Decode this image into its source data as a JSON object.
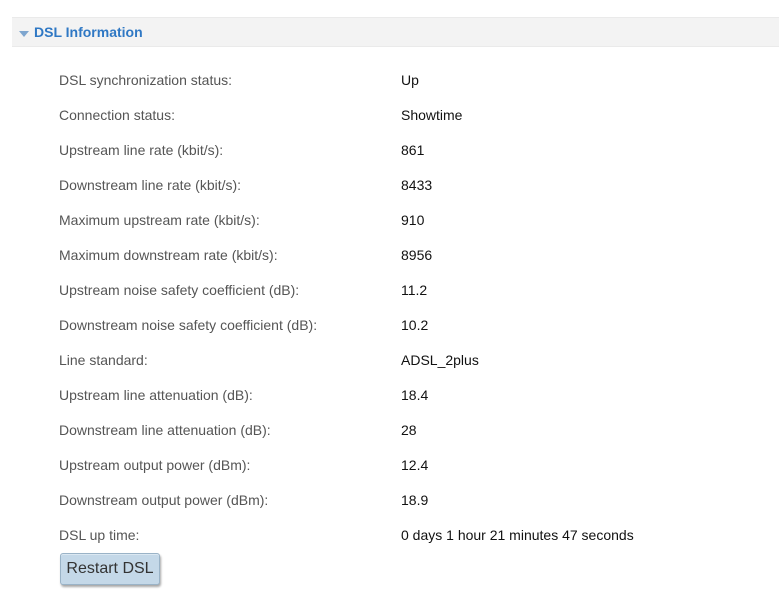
{
  "section": {
    "title": "DSL Information"
  },
  "rows": [
    {
      "label": "DSL synchronization status:",
      "value": "Up"
    },
    {
      "label": "Connection status:",
      "value": "Showtime"
    },
    {
      "label": "Upstream line rate (kbit/s):",
      "value": "861"
    },
    {
      "label": "Downstream line rate (kbit/s):",
      "value": "8433"
    },
    {
      "label": "Maximum upstream rate (kbit/s):",
      "value": "910"
    },
    {
      "label": "Maximum downstream rate (kbit/s):",
      "value": "8956"
    },
    {
      "label": "Upstream noise safety coefficient (dB):",
      "value": "11.2"
    },
    {
      "label": "Downstream noise safety coefficient (dB):",
      "value": "10.2"
    },
    {
      "label": "Line standard:",
      "value": "ADSL_2plus"
    },
    {
      "label": "Upstream line attenuation (dB):",
      "value": "18.4"
    },
    {
      "label": "Downstream line attenuation (dB):",
      "value": "28"
    },
    {
      "label": "Upstream output power (dBm):",
      "value": "12.4"
    },
    {
      "label": "Downstream output power (dBm):",
      "value": "18.9"
    },
    {
      "label": "DSL up time:",
      "value": "0 days 1 hour 21 minutes 47 seconds"
    }
  ],
  "actions": {
    "restart_label": "Restart DSL"
  },
  "colors": {
    "section_title": "#2f78c4",
    "header_bg": "#f3f3f3",
    "button_bg": "#c4d8e8"
  },
  "icons": {
    "section_toggle": "caret-down-icon"
  }
}
